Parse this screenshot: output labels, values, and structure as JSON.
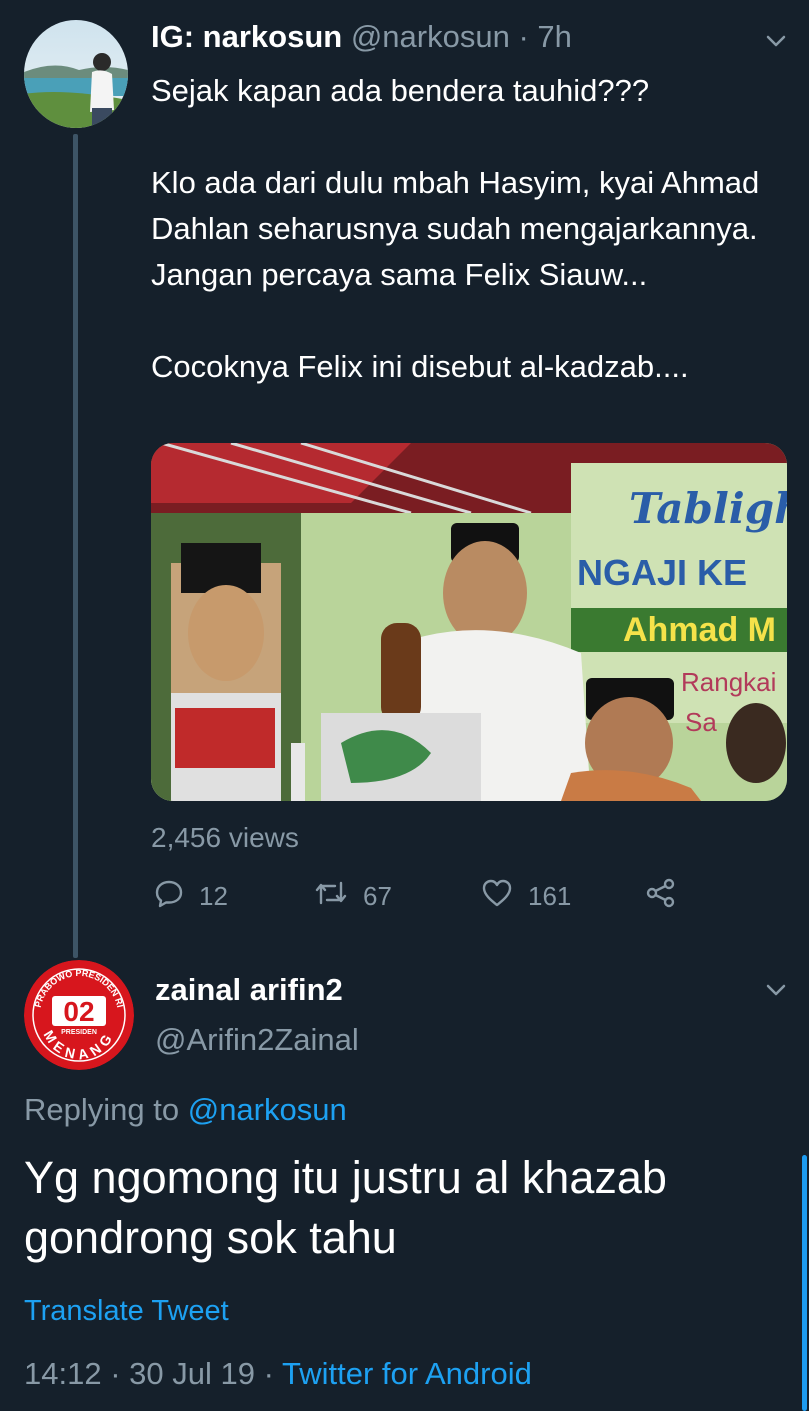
{
  "tweet1": {
    "display_name": "IG: narkosun",
    "handle": "@narkosun",
    "separator": "·",
    "time": "7h",
    "paragraphs": [
      "Sejak kapan ada bendera tauhid???",
      "Klo ada dari dulu mbah Hasyim, kyai Ahmad Dahlan seharusnya sudah mengajarkannya. Jangan percaya sama Felix Siauw...",
      "Cocoknya Felix ini disebut al-kadzab...."
    ],
    "media": {
      "banner_line1": "Tabligh",
      "banner_line2": "NGAJI KE",
      "banner_line3": "Ahmad M",
      "banner_line4": "Rangkai",
      "banner_line5": "Sa"
    },
    "views": "2,456 views",
    "actions": {
      "reply_count": "12",
      "retweet_count": "67",
      "like_count": "161"
    }
  },
  "tweet2": {
    "display_name": "zainal arifin2",
    "handle": "@Arifin2Zainal",
    "avatar_badge": "02",
    "avatar_text_top": "PRABOWO PRESIDEN RI",
    "avatar_text_bottom": "MENANG",
    "avatar_text_mid": "PRESIDEN",
    "replying_prefix": "Replying to",
    "replying_to": "@narkosun",
    "text": "Yg ngomong itu justru al khazab gondrong sok tahu",
    "translate": "Translate Tweet",
    "time": "14:12",
    "separator": "·",
    "date": "30 Jul 19",
    "source": "Twitter for Android"
  },
  "icons": [
    "chevron-down-icon",
    "reply-icon",
    "retweet-icon",
    "like-icon",
    "share-icon"
  ],
  "colors": {
    "background": "#15202b",
    "text": "#ffffff",
    "muted": "#8899a6",
    "link": "#1da1f2",
    "thread_line": "#3d5466"
  }
}
